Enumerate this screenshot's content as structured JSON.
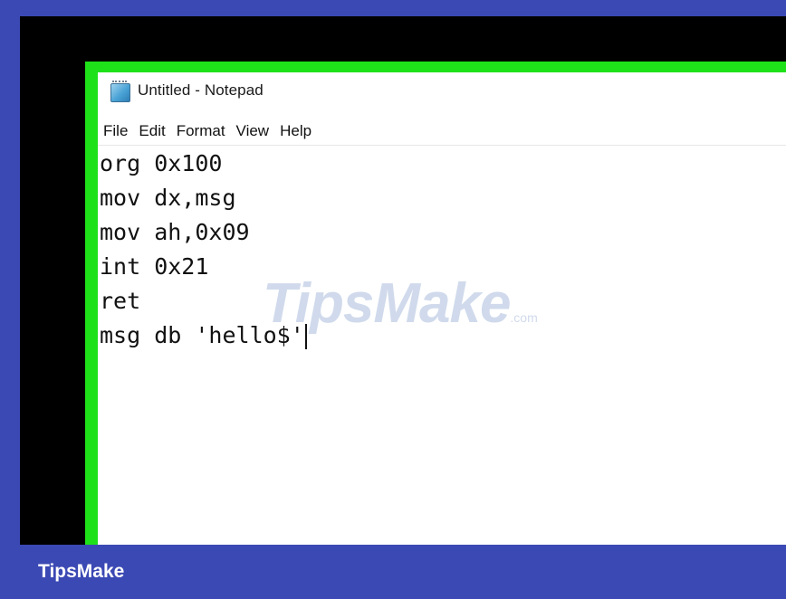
{
  "window": {
    "title": "Untitled - Notepad"
  },
  "menu": [
    "File",
    "Edit",
    "Format",
    "View",
    "Help"
  ],
  "editor": {
    "lines": [
      "org 0x100",
      "mov dx,msg",
      "mov ah,0x09",
      "int 0x21",
      "ret",
      "msg db 'hello$'"
    ]
  },
  "watermark": {
    "text": "TipsMake",
    "suffix": ".com"
  },
  "footer": {
    "brand": "TipsMake"
  },
  "colors": {
    "frame": "#3b49b4",
    "screen": "#000000",
    "highlight_border": "#1fe11a"
  }
}
